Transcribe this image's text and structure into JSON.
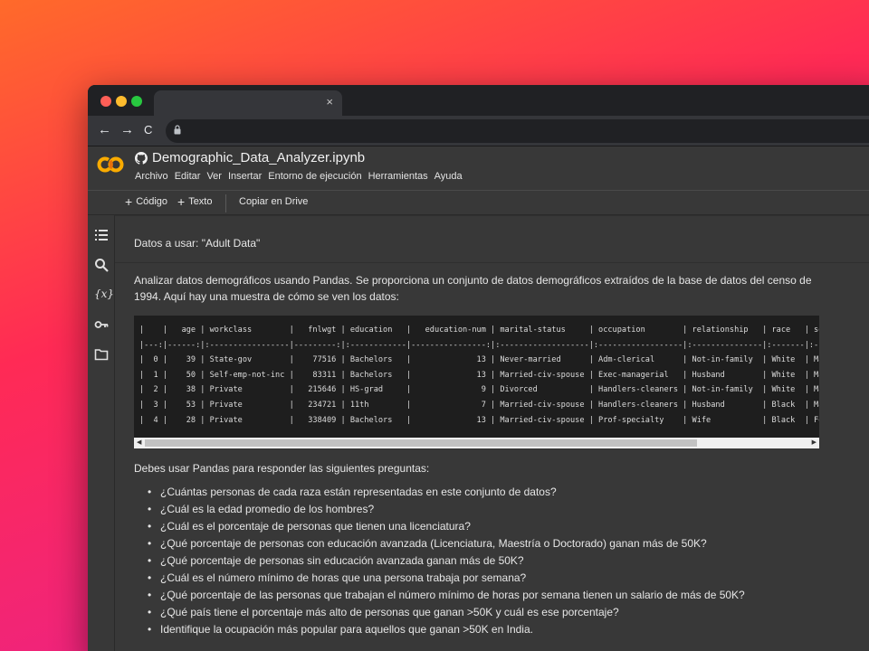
{
  "browser": {
    "tab_close": "×",
    "back": "←",
    "forward": "→",
    "reload": "C"
  },
  "colab": {
    "notebook_title": "Demographic_Data_Analyzer.ipynb",
    "menu": [
      "Archivo",
      "Editar",
      "Ver",
      "Insertar",
      "Entorno de ejecución",
      "Herramientas",
      "Ayuda"
    ],
    "toolbar": {
      "code_label": "Código",
      "text_label": "Texto",
      "drive_label": "Copiar en Drive"
    }
  },
  "notebook": {
    "data_heading": "Datos a usar: \"Adult Data\"",
    "intro_line1": "Analizar datos demográficos usando Pandas. Se proporciona un conjunto de datos demográficos extraídos de la base de datos del censo de",
    "intro_line2": "1994. Aquí hay una muestra de cómo se ven los datos:",
    "table_text": "|    |   age | workclass        |   fnlwgt | education   |   education-num | marital-status     | occupation        | relationship   | race   | se\n|---:|------:|:-----------------|---------:|:------------|----------------:|:-------------------|:------------------|:---------------|:-------|:--\n|  0 |    39 | State-gov        |    77516 | Bachelors   |              13 | Never-married      | Adm-clerical      | Not-in-family  | White  | Ma\n|  1 |    50 | Self-emp-not-inc |    83311 | Bachelors   |              13 | Married-civ-spouse | Exec-managerial   | Husband        | White  | Ma\n|  2 |    38 | Private          |   215646 | HS-grad     |               9 | Divorced           | Handlers-cleaners | Not-in-family  | White  | Ma\n|  3 |    53 | Private          |   234721 | 11th        |               7 | Married-civ-spouse | Handlers-cleaners | Husband        | Black  | Ma\n|  4 |    28 | Private          |   338409 | Bachelors   |              13 | Married-civ-spouse | Prof-specialty    | Wife           | Black  | Fe",
    "questions_intro": "Debes usar Pandas para responder las siguientes preguntas:",
    "questions": [
      "¿Cuántas personas de cada raza están representadas en este conjunto de datos?",
      "¿Cuál es la edad promedio de los hombres?",
      "¿Cuál es el porcentaje de personas que tienen una licenciatura?",
      "¿Qué porcentaje de personas con educación avanzada (Licenciatura, Maestría o Doctorado) ganan más de 50K?",
      "¿Qué porcentaje de personas sin educación avanzada ganan más de 50K?",
      "¿Cuál es el número mínimo de horas que una persona trabaja por semana?",
      "¿Qué porcentaje de las personas que trabajan el número mínimo de horas por semana tienen un salario de más de 50K?",
      "¿Qué país tiene el porcentaje más alto de personas que ganan >50K y cuál es ese porcentaje?",
      "Identifique la ocupación más popular para aquellos que ganan >50K en India."
    ]
  },
  "colors": {
    "logo_orange": "#f9ab00",
    "logo_dark_orange": "#e8710a",
    "dark_bg": "#383838"
  }
}
